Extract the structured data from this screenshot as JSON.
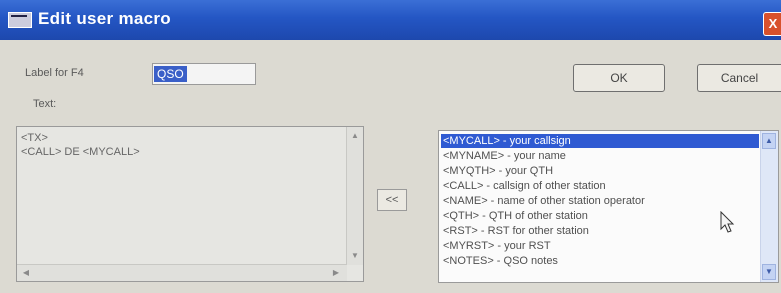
{
  "window": {
    "title": "Edit user macro",
    "close_glyph": "X"
  },
  "form": {
    "label_field_label": "Label for F4",
    "label_value": "QSO",
    "text_label": "Text:"
  },
  "buttons": {
    "ok": "OK",
    "cancel": "Cancel",
    "insert": "<<"
  },
  "text_area": {
    "lines": [
      "<TX>",
      "<CALL> DE <MYCALL>"
    ]
  },
  "macro_list": {
    "selected_index": 0,
    "items": [
      "<MYCALL> - your callsign",
      "<MYNAME> - your name",
      "<MYQTH> - your QTH",
      "<CALL> - callsign of other station",
      "<NAME> - name of other station operator",
      "<QTH> - QTH of other station",
      "<RST> - RST for other station",
      "<MYRST> - your RST",
      "<NOTES> - QSO notes"
    ]
  },
  "icons": {
    "app": "window-app-icon",
    "close": "close-icon",
    "scroll_up": "scroll-up-arrow-icon",
    "scroll_down": "scroll-down-arrow-icon",
    "scroll_left": "scroll-left-arrow-icon",
    "scroll_right": "scroll-right-arrow-icon",
    "cursor": "mouse-cursor-icon"
  },
  "colors": {
    "title_bar": "#2456c4",
    "selection": "#2f5ad2",
    "close_button": "#d8512c"
  }
}
